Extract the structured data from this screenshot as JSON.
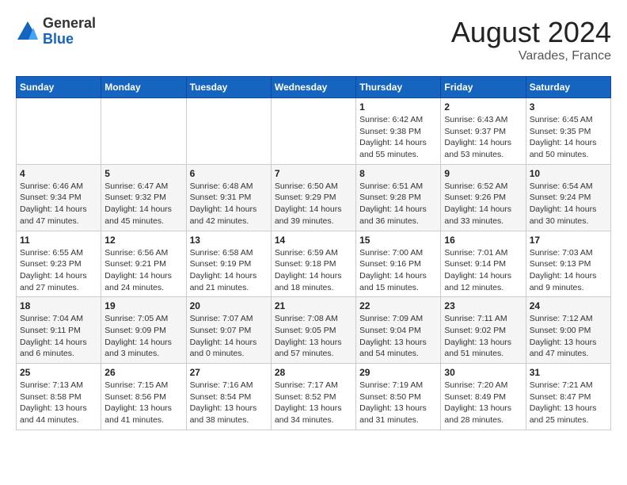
{
  "header": {
    "logo_general": "General",
    "logo_blue": "Blue",
    "title": "August 2024",
    "location": "Varades, France"
  },
  "days_of_week": [
    "Sunday",
    "Monday",
    "Tuesday",
    "Wednesday",
    "Thursday",
    "Friday",
    "Saturday"
  ],
  "weeks": [
    [
      {
        "day": "",
        "info": ""
      },
      {
        "day": "",
        "info": ""
      },
      {
        "day": "",
        "info": ""
      },
      {
        "day": "",
        "info": ""
      },
      {
        "day": "1",
        "info": "Sunrise: 6:42 AM\nSunset: 9:38 PM\nDaylight: 14 hours\nand 55 minutes."
      },
      {
        "day": "2",
        "info": "Sunrise: 6:43 AM\nSunset: 9:37 PM\nDaylight: 14 hours\nand 53 minutes."
      },
      {
        "day": "3",
        "info": "Sunrise: 6:45 AM\nSunset: 9:35 PM\nDaylight: 14 hours\nand 50 minutes."
      }
    ],
    [
      {
        "day": "4",
        "info": "Sunrise: 6:46 AM\nSunset: 9:34 PM\nDaylight: 14 hours\nand 47 minutes."
      },
      {
        "day": "5",
        "info": "Sunrise: 6:47 AM\nSunset: 9:32 PM\nDaylight: 14 hours\nand 45 minutes."
      },
      {
        "day": "6",
        "info": "Sunrise: 6:48 AM\nSunset: 9:31 PM\nDaylight: 14 hours\nand 42 minutes."
      },
      {
        "day": "7",
        "info": "Sunrise: 6:50 AM\nSunset: 9:29 PM\nDaylight: 14 hours\nand 39 minutes."
      },
      {
        "day": "8",
        "info": "Sunrise: 6:51 AM\nSunset: 9:28 PM\nDaylight: 14 hours\nand 36 minutes."
      },
      {
        "day": "9",
        "info": "Sunrise: 6:52 AM\nSunset: 9:26 PM\nDaylight: 14 hours\nand 33 minutes."
      },
      {
        "day": "10",
        "info": "Sunrise: 6:54 AM\nSunset: 9:24 PM\nDaylight: 14 hours\nand 30 minutes."
      }
    ],
    [
      {
        "day": "11",
        "info": "Sunrise: 6:55 AM\nSunset: 9:23 PM\nDaylight: 14 hours\nand 27 minutes."
      },
      {
        "day": "12",
        "info": "Sunrise: 6:56 AM\nSunset: 9:21 PM\nDaylight: 14 hours\nand 24 minutes."
      },
      {
        "day": "13",
        "info": "Sunrise: 6:58 AM\nSunset: 9:19 PM\nDaylight: 14 hours\nand 21 minutes."
      },
      {
        "day": "14",
        "info": "Sunrise: 6:59 AM\nSunset: 9:18 PM\nDaylight: 14 hours\nand 18 minutes."
      },
      {
        "day": "15",
        "info": "Sunrise: 7:00 AM\nSunset: 9:16 PM\nDaylight: 14 hours\nand 15 minutes."
      },
      {
        "day": "16",
        "info": "Sunrise: 7:01 AM\nSunset: 9:14 PM\nDaylight: 14 hours\nand 12 minutes."
      },
      {
        "day": "17",
        "info": "Sunrise: 7:03 AM\nSunset: 9:13 PM\nDaylight: 14 hours\nand 9 minutes."
      }
    ],
    [
      {
        "day": "18",
        "info": "Sunrise: 7:04 AM\nSunset: 9:11 PM\nDaylight: 14 hours\nand 6 minutes."
      },
      {
        "day": "19",
        "info": "Sunrise: 7:05 AM\nSunset: 9:09 PM\nDaylight: 14 hours\nand 3 minutes."
      },
      {
        "day": "20",
        "info": "Sunrise: 7:07 AM\nSunset: 9:07 PM\nDaylight: 14 hours and 0 minutes."
      },
      {
        "day": "21",
        "info": "Sunrise: 7:08 AM\nSunset: 9:05 PM\nDaylight: 13 hours\nand 57 minutes."
      },
      {
        "day": "22",
        "info": "Sunrise: 7:09 AM\nSunset: 9:04 PM\nDaylight: 13 hours\nand 54 minutes."
      },
      {
        "day": "23",
        "info": "Sunrise: 7:11 AM\nSunset: 9:02 PM\nDaylight: 13 hours\nand 51 minutes."
      },
      {
        "day": "24",
        "info": "Sunrise: 7:12 AM\nSunset: 9:00 PM\nDaylight: 13 hours\nand 47 minutes."
      }
    ],
    [
      {
        "day": "25",
        "info": "Sunrise: 7:13 AM\nSunset: 8:58 PM\nDaylight: 13 hours\nand 44 minutes."
      },
      {
        "day": "26",
        "info": "Sunrise: 7:15 AM\nSunset: 8:56 PM\nDaylight: 13 hours\nand 41 minutes."
      },
      {
        "day": "27",
        "info": "Sunrise: 7:16 AM\nSunset: 8:54 PM\nDaylight: 13 hours\nand 38 minutes."
      },
      {
        "day": "28",
        "info": "Sunrise: 7:17 AM\nSunset: 8:52 PM\nDaylight: 13 hours\nand 34 minutes."
      },
      {
        "day": "29",
        "info": "Sunrise: 7:19 AM\nSunset: 8:50 PM\nDaylight: 13 hours\nand 31 minutes."
      },
      {
        "day": "30",
        "info": "Sunrise: 7:20 AM\nSunset: 8:49 PM\nDaylight: 13 hours\nand 28 minutes."
      },
      {
        "day": "31",
        "info": "Sunrise: 7:21 AM\nSunset: 8:47 PM\nDaylight: 13 hours\nand 25 minutes."
      }
    ]
  ]
}
